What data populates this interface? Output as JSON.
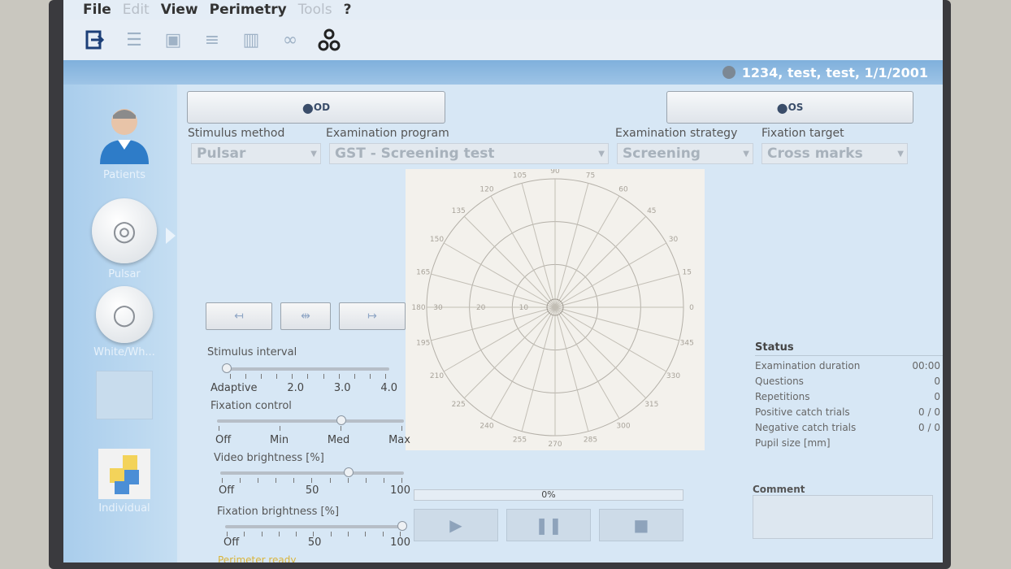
{
  "menu": {
    "items": [
      {
        "label": "File",
        "enabled": true
      },
      {
        "label": "Edit",
        "enabled": false
      },
      {
        "label": "View",
        "enabled": true
      },
      {
        "label": "Perimetry",
        "enabled": true
      },
      {
        "label": "Tools",
        "enabled": false
      },
      {
        "label": "?",
        "enabled": true
      }
    ]
  },
  "toolbar": {
    "icons": [
      "exit-icon",
      "list-icon",
      "save-icon",
      "print-icon",
      "database-icon",
      "glasses-icon",
      "connection-icon"
    ]
  },
  "patient": {
    "label": "1234, test, test, 1/1/2001"
  },
  "sidebar": {
    "items": [
      {
        "label": "Patients"
      },
      {
        "label": "Pulsar"
      },
      {
        "label": "White/Wh..."
      },
      {
        "label": ""
      },
      {
        "label": "Individual"
      }
    ]
  },
  "eyes": {
    "od_label": "OD",
    "os_label": "OS"
  },
  "fields": {
    "stimulus_method": {
      "label": "Stimulus method",
      "value": "Pulsar"
    },
    "examination_program": {
      "label": "Examination program",
      "value": "GST - Screening test"
    },
    "examination_strategy": {
      "label": "Examination strategy",
      "value": "Screening"
    },
    "fixation_target": {
      "label": "Fixation target",
      "value": "Cross marks"
    }
  },
  "plot": {
    "angles": [
      "90",
      "75",
      "60",
      "45",
      "30",
      "15",
      "0",
      "345",
      "330",
      "315",
      "300",
      "285",
      "270",
      "255",
      "240",
      "225",
      "210",
      "195",
      "180",
      "165",
      "150",
      "135",
      "120",
      "105"
    ],
    "radii": [
      "10",
      "20",
      "30"
    ]
  },
  "sliders": {
    "stimulus_interval": {
      "label": "Stimulus interval",
      "ticks": [
        "Adaptive",
        "2.0",
        "3.0",
        "4.0"
      ],
      "level": 0.0
    },
    "fixation_control": {
      "label": "Fixation control",
      "ticks": [
        "Off",
        "Min",
        "Med",
        "Max"
      ],
      "level": 0.667
    },
    "video_brightness": {
      "label": "Video brightness [%]",
      "ticks": [
        "Off",
        "50",
        "100"
      ],
      "level": 0.7
    },
    "fixation_brightness": {
      "label": "Fixation brightness [%]",
      "ticks": [
        "Off",
        "50",
        "100"
      ],
      "level": 1.0
    }
  },
  "status": {
    "title": "Status",
    "rows": [
      {
        "label": "Examination duration",
        "value": "00:00"
      },
      {
        "label": "Questions",
        "value": "0"
      },
      {
        "label": "Repetitions",
        "value": "0"
      },
      {
        "label": "Positive catch trials",
        "value": "0 / 0"
      },
      {
        "label": "Negative catch trials",
        "value": "0 / 0"
      },
      {
        "label": "Pupil size [mm]",
        "value": ""
      }
    ]
  },
  "progress": {
    "label": "0%",
    "value": 0
  },
  "comment": {
    "label": "Comment",
    "value": ""
  },
  "statusline": "Perimeter ready"
}
